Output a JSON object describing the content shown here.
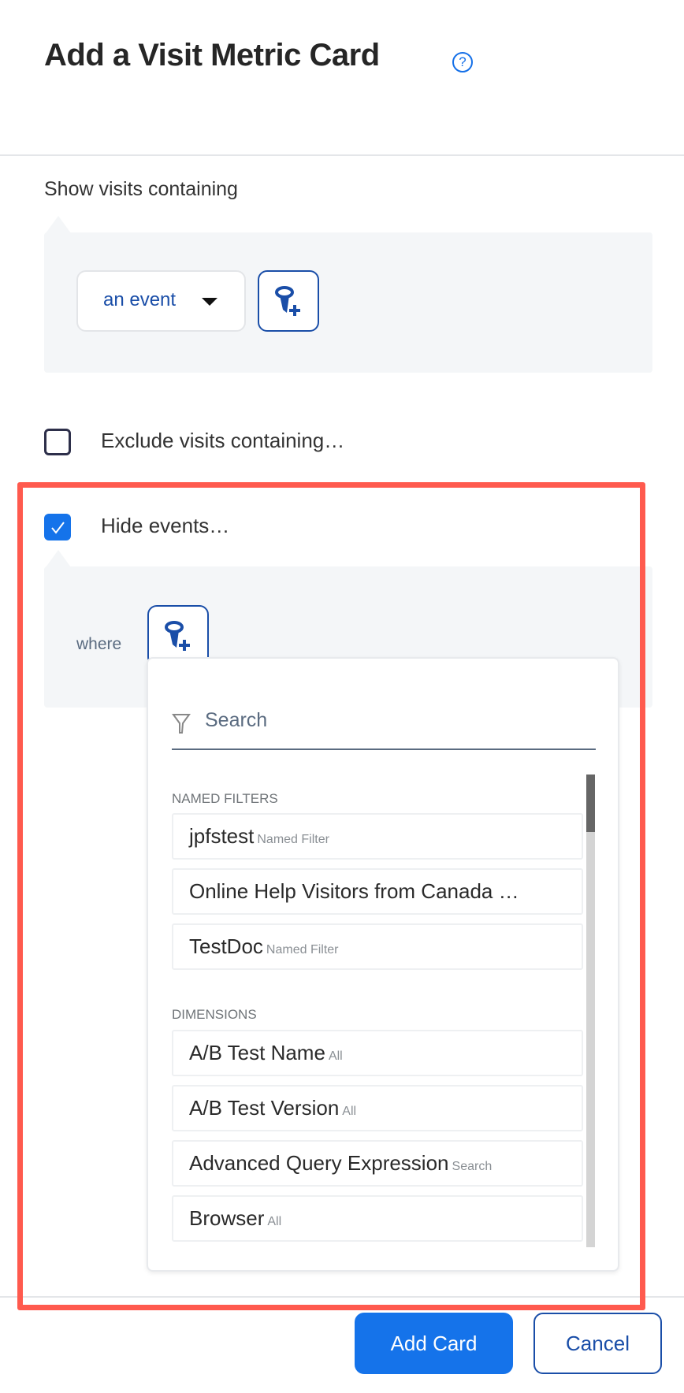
{
  "header": {
    "title": "Add a Visit Metric Card",
    "help_icon": "?"
  },
  "show_section": {
    "label": "Show visits containing",
    "dropdown_value": "an event",
    "add_filter_icon": "filter-plus-icon"
  },
  "exclude": {
    "label": "Exclude visits containing…",
    "checked": false
  },
  "hide": {
    "label": "Hide events…",
    "checked": true,
    "where_label": "where"
  },
  "popup": {
    "search_placeholder": "Search",
    "sections": [
      {
        "title": "NAMED FILTERS",
        "items": [
          {
            "name": "jpfstest",
            "type": "Named Filter"
          },
          {
            "name": "Online Help Visitors from Canada …",
            "type": ""
          },
          {
            "name": "TestDoc",
            "type": "Named Filter"
          }
        ]
      },
      {
        "title": "DIMENSIONS",
        "items": [
          {
            "name": "A/B Test Name",
            "type": "All"
          },
          {
            "name": "A/B Test Version",
            "type": "All"
          },
          {
            "name": "Advanced Query Expression",
            "type": "Search"
          },
          {
            "name": "Browser",
            "type": "All"
          }
        ]
      }
    ]
  },
  "footer": {
    "add_label": "Add Card",
    "cancel_label": "Cancel"
  },
  "colors": {
    "primary": "#1573ea",
    "outline": "#1a4ea8",
    "highlight": "#ff5a4e"
  }
}
